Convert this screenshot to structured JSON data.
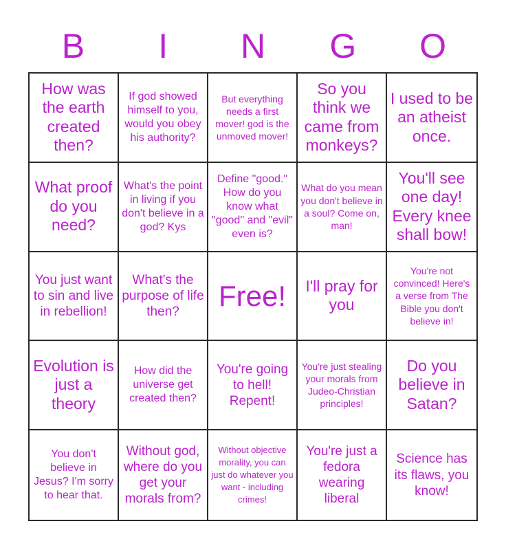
{
  "card": {
    "header_letters": [
      "B",
      "I",
      "N",
      "G",
      "O"
    ],
    "accent_color": "#bb22cc",
    "border_color": "#2b2b2b",
    "background_color": "#ffffff",
    "grid_size": "5x5",
    "free_space_index": 12,
    "cells": [
      {
        "text": "How was the earth created then?",
        "size": "lg",
        "free": false
      },
      {
        "text": "If god showed himself to you, would you obey his authority?",
        "size": "sm",
        "free": false
      },
      {
        "text": "But everything needs a first mover! god is the unmoved mover!",
        "size": "xs",
        "free": false
      },
      {
        "text": "So you think we came from monkeys?",
        "size": "lg",
        "free": false
      },
      {
        "text": "I used to be an atheist once.",
        "size": "lg",
        "free": false
      },
      {
        "text": "What proof do you need?",
        "size": "lg",
        "free": false
      },
      {
        "text": "What's the point in living if you don't believe in a god? Kys",
        "size": "sm",
        "free": false
      },
      {
        "text": "Define \"good.\" How do you know what \"good\" and \"evil\" even is?",
        "size": "sm",
        "free": false
      },
      {
        "text": "What do you mean you don't believe in a soul? Come on, man!",
        "size": "xs",
        "free": false
      },
      {
        "text": "You'll see one day! Every knee shall bow!",
        "size": "lg",
        "free": false
      },
      {
        "text": "You just want to sin and live in rebellion!",
        "size": "md",
        "free": false
      },
      {
        "text": "What's the purpose of life then?",
        "size": "md",
        "free": false
      },
      {
        "text": "Free!",
        "size": "xl",
        "free": true
      },
      {
        "text": "I'll pray for you",
        "size": "lg",
        "free": false
      },
      {
        "text": "You're not convinced! Here's a verse from The Bible you don't believe in!",
        "size": "xs",
        "free": false
      },
      {
        "text": "Evolution is just a theory",
        "size": "lg",
        "free": false
      },
      {
        "text": "How did the universe get created then?",
        "size": "sm",
        "free": false
      },
      {
        "text": "You're going to hell! Repent!",
        "size": "md",
        "free": false
      },
      {
        "text": "You're just stealing your morals from Judeo-Christian principles!",
        "size": "xs",
        "free": false
      },
      {
        "text": "Do you believe in Satan?",
        "size": "lg",
        "free": false
      },
      {
        "text": "You don't believe in Jesus? I'm sorry to hear that.",
        "size": "sm",
        "free": false
      },
      {
        "text": "Without god, where do you get your morals from?",
        "size": "md",
        "free": false
      },
      {
        "text": "Without objective morality, you can just do whatever you want - including crimes!",
        "size": "xxs",
        "free": false
      },
      {
        "text": "You're just a fedora wearing liberal",
        "size": "md",
        "free": false
      },
      {
        "text": "Science has its flaws, you know!",
        "size": "md",
        "free": false
      }
    ]
  }
}
